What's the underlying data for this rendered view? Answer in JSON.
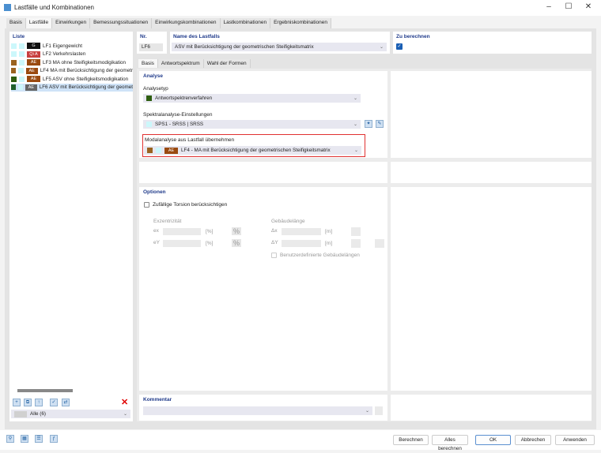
{
  "window": {
    "title": "Lastfälle und Kombinationen"
  },
  "tabs": [
    "Basis",
    "Lastfälle",
    "Einwirkungen",
    "Bemessungssituationen",
    "Einwirkungskombinationen",
    "Lastkombinationen",
    "Ergebniskombinationen"
  ],
  "list": {
    "header": "Liste",
    "items": [
      {
        "c1": "#ccf7fb",
        "c2": "#ccf7fb",
        "badge": "G",
        "badge_color": "#111111",
        "label": "LF1 Eigengewicht"
      },
      {
        "c1": "#ccf7fb",
        "c2": "#ccf7fb",
        "badge": "Qi A",
        "badge_color": "#c84040",
        "label": "LF2 Verkehrslasten"
      },
      {
        "c1": "#9a6320",
        "c2": "#ccf7fb",
        "badge": "AE",
        "badge_color": "#9a4a10",
        "label": "LF3 MA ohne Steifigkeitsmodigikation"
      },
      {
        "c1": "#9a6320",
        "c2": "#ccf7fb",
        "badge": "AE",
        "badge_color": "#9a4a10",
        "label": "LF4 MA mit Berücksichtigung der geometr"
      },
      {
        "c1": "#2e5e10",
        "c2": "#ccf7fb",
        "badge": "AE",
        "badge_color": "#9a4a10",
        "label": "LF5 ASV ohne Steifigkeitsmodigikation"
      },
      {
        "c1": "#1f5f2a",
        "c2": "#ccf7fb",
        "badge": "AE",
        "badge_color": "#666666",
        "label": "LF6 ASV mit Berücksichtigung der geomet"
      }
    ],
    "filter": "Alle (6)"
  },
  "nr": {
    "label": "Nr.",
    "value": "LF6"
  },
  "name": {
    "label": "Name des Lastfalls",
    "value": "ASV mit Berücksichtigung der geometrischen Steifigkeitsmatrix"
  },
  "calc": {
    "label": "Zu berechnen",
    "checked": true
  },
  "subtabs": [
    "Basis",
    "Antwortspektrum",
    "Wahl der Formen"
  ],
  "analyse": {
    "header": "Analyse",
    "type_label": "Analysetyp",
    "type_value": "Antwortspektrenverfahren",
    "type_color": "#2e5e10",
    "spectral_label": "Spektralanalyse-Einstellungen",
    "spectral_value": "SPS1 - SRSS | SRSS",
    "modal_label": "Modalanalyse aus Lastfall übernehmen",
    "modal_badge": "AE",
    "modal_value": "LF4 - MA mit Berücksichtigung der geometrischen Steifigkeitsmatrix"
  },
  "options": {
    "header": "Optionen",
    "torsion": "Zufällige Torsion berücksichtigen",
    "ecc": "Exzentrizität",
    "ex": "ex",
    "ey": "eY",
    "unit_pct": "[%]",
    "pct": "%",
    "len": "Gebäudelänge",
    "dx": "Δx",
    "dy": "ΔY",
    "unit_m": "[m]",
    "custom": "Benutzerdefinierte Gebäudelängen"
  },
  "comment": {
    "label": "Kommentar"
  },
  "buttons": {
    "calc": "Berechnen",
    "calc_all": "Alles berechnen",
    "ok": "OK",
    "cancel": "Abbrechen",
    "apply": "Anwenden"
  }
}
